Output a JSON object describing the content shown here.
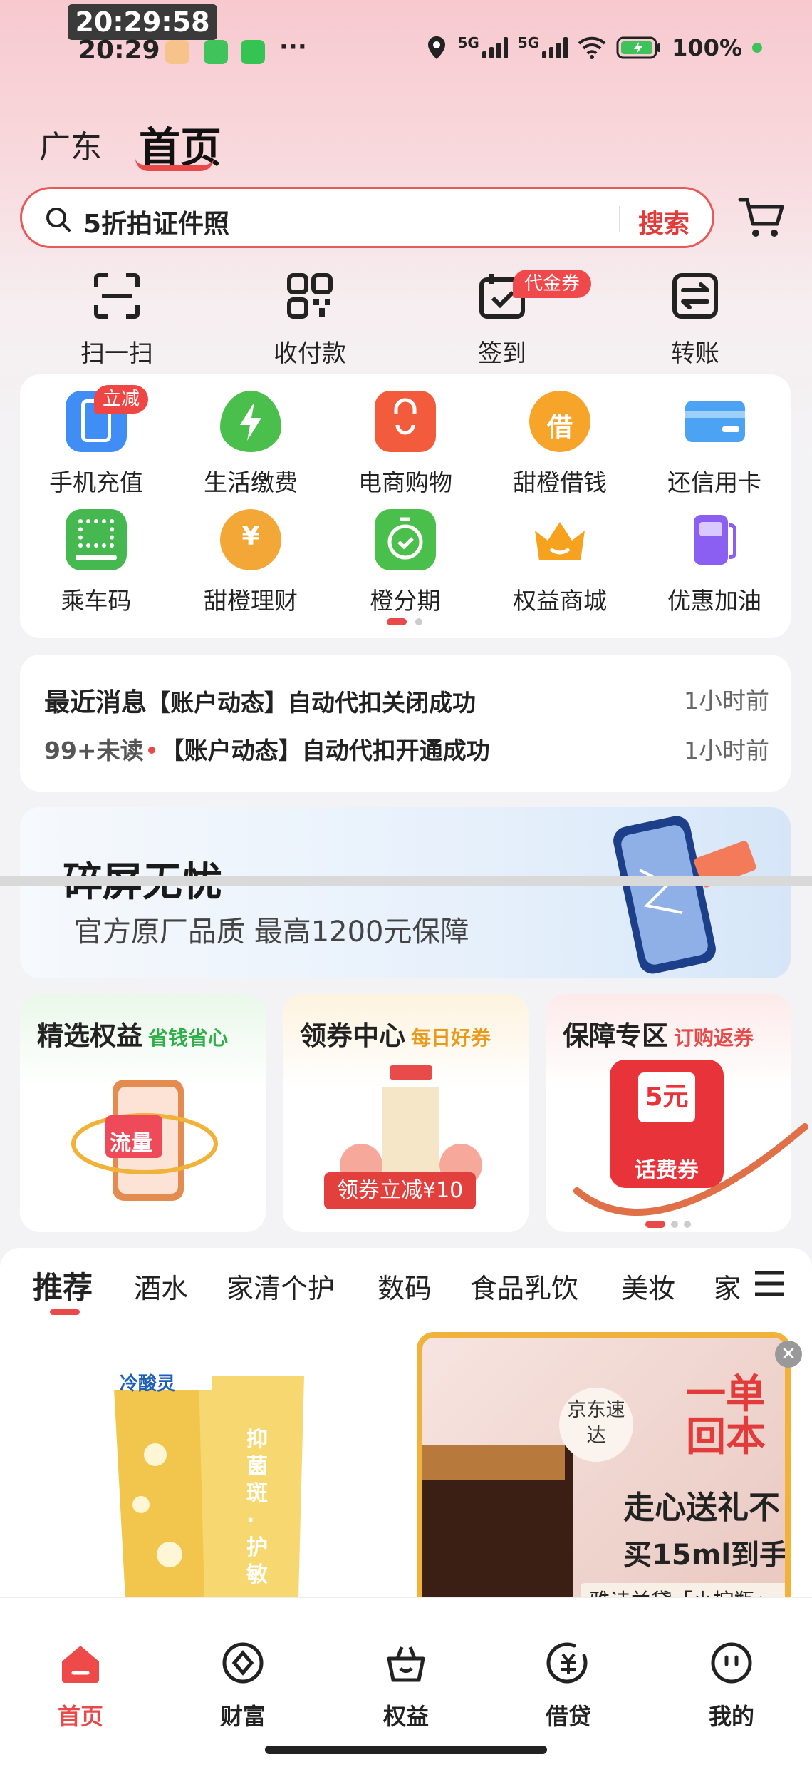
{
  "status_bar": {
    "overlay_time": "20:29:58",
    "time": "20:29",
    "more": "···",
    "net_1": "5G",
    "net_2": "5G",
    "battery": "100%"
  },
  "header": {
    "region": "广东",
    "title": "首页"
  },
  "search": {
    "placeholder": "5折拍证件照",
    "button_label": "搜索"
  },
  "quick_actions": [
    {
      "label": "扫一扫",
      "icon": "scan-icon"
    },
    {
      "label": "收付款",
      "icon": "qr-pay-icon"
    },
    {
      "label": "签到",
      "icon": "calendar-check-icon",
      "badge": "代金券"
    },
    {
      "label": "转账",
      "icon": "transfer-icon"
    }
  ],
  "services": [
    {
      "label": "手机充值",
      "icon": "phone-recharge-icon",
      "badge": "立减",
      "color": "#3f8df5"
    },
    {
      "label": "生活缴费",
      "icon": "lightning-icon",
      "color": "#4bbf4b"
    },
    {
      "label": "电商购物",
      "icon": "shopping-bag-icon",
      "color": "#f25c3c"
    },
    {
      "label": "甜橙借钱",
      "icon": "borrow-icon",
      "color": "#f7a42b"
    },
    {
      "label": "还信用卡",
      "icon": "credit-card-icon",
      "color": "#4da3f3"
    },
    {
      "label": "乘车码",
      "icon": "bus-code-icon",
      "color": "#45b84f"
    },
    {
      "label": "甜橙理财",
      "icon": "coin-hand-icon",
      "color": "#f3a737"
    },
    {
      "label": "橙分期",
      "icon": "installment-icon",
      "color": "#4bbf4b"
    },
    {
      "label": "权益商城",
      "icon": "crown-icon",
      "color": "#f6a21e"
    },
    {
      "label": "优惠加油",
      "icon": "fuel-pump-icon",
      "color": "#8a5ff2"
    }
  ],
  "messages": {
    "row1_label": "最近消息",
    "row1_text": "【账户动态】自动代扣关闭成功",
    "row1_time": "1小时前",
    "row2_label": "99+未读",
    "row2_text": "【账户动态】自动代扣开通成功",
    "row2_time": "1小时前"
  },
  "banner": {
    "headline": "碎屏无忧",
    "subtitle": "官方原厂品质 最高1200元保障"
  },
  "feature_cards": [
    {
      "title": "精选权益",
      "subtitle": "省钱省心",
      "subtitle_color": "#2fae4a",
      "image_text": "流量"
    },
    {
      "title": "领券中心",
      "subtitle": "每日好券",
      "subtitle_color": "#e89a1a",
      "image_text": "领券立减¥10"
    },
    {
      "title": "保障专区",
      "subtitle": "订购返券",
      "subtitle_color": "#e84a4a",
      "image_text": "5元",
      "image_text_2": "话费券"
    }
  ],
  "category_tabs": [
    "推荐",
    "酒水",
    "家清个护",
    "数码",
    "食品乳饮",
    "美妆",
    "家"
  ],
  "products": {
    "left_brand": "冷酸灵",
    "left_text": "抑菌斑·护敏",
    "right_badge": "京东速达",
    "right_corner": "一单回本",
    "right_line1": "走心送礼不",
    "right_line2": "买15ml到手",
    "right_caption": "雅诗兰黛「小棕瓶」"
  },
  "bottom_nav": [
    {
      "label": "首页",
      "icon": "home-icon",
      "active": true
    },
    {
      "label": "财富",
      "icon": "wealth-icon"
    },
    {
      "label": "权益",
      "icon": "rights-basket-icon"
    },
    {
      "label": "借贷",
      "icon": "loan-icon"
    },
    {
      "label": "我的",
      "icon": "profile-icon"
    }
  ],
  "colors": {
    "accent": "#e84a4a",
    "header_gradient": "#f7c9cf"
  }
}
